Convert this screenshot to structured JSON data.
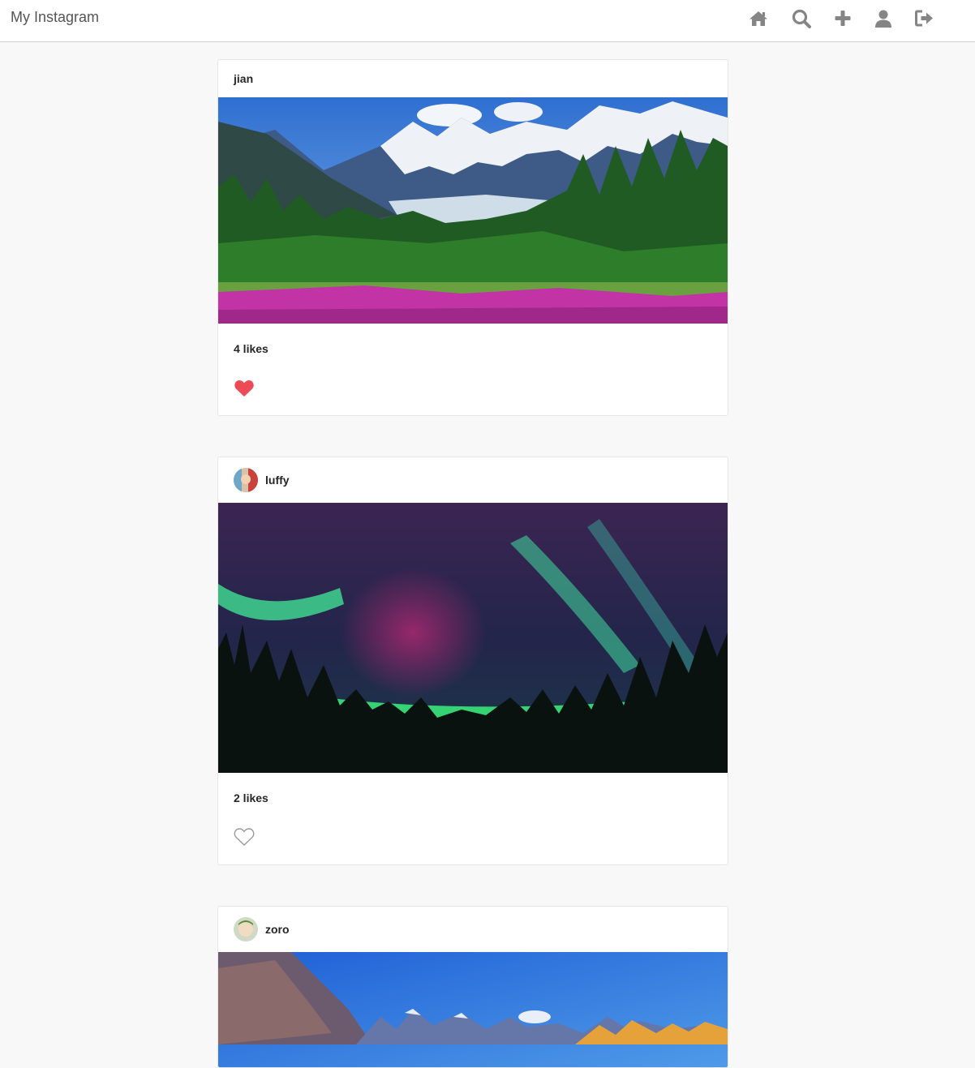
{
  "app": {
    "brand": "My Instagram"
  },
  "nav": {
    "icons": [
      "home-icon",
      "search-icon",
      "plus-icon",
      "user-icon",
      "logout-icon"
    ],
    "icon_color": "#858585"
  },
  "posts": [
    {
      "username": "jian",
      "likes": "4 likes",
      "liked": true,
      "image": "mountain-glacier-meadow"
    },
    {
      "username": "luffy",
      "likes": "2 likes",
      "liked": false,
      "image": "aurora-forest"
    },
    {
      "username": "zoro",
      "likes": "",
      "liked": false,
      "image": "mountain-lake-sunrise"
    }
  ],
  "colors": {
    "liked_heart": "#ed4956",
    "unliked_heart": "#9b9b9b",
    "background": "#f8f8f8",
    "card": "#ffffff"
  }
}
